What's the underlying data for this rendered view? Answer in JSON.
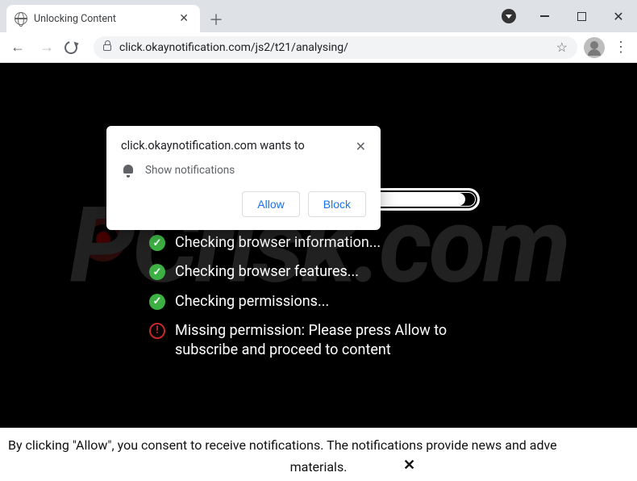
{
  "window": {
    "tab_title": "Unlocking Content"
  },
  "toolbar": {
    "url": "click.okaynotification.com/js2/t21/analysing/"
  },
  "permission_popup": {
    "origin_text": "click.okaynotification.com wants to",
    "request_label": "Show notifications",
    "allow_label": "Allow",
    "block_label": "Block"
  },
  "page": {
    "checks": [
      {
        "status": "ok",
        "text": "Checking browser information..."
      },
      {
        "status": "ok",
        "text": "Checking browser features..."
      },
      {
        "status": "ok",
        "text": "Checking permissions..."
      },
      {
        "status": "error",
        "text": "Missing permission: Please press Allow to subscribe and proceed to content"
      }
    ],
    "progress_percent": 97
  },
  "footer": {
    "line1": "By clicking \"Allow\", you consent to receive notifications. The notifications provide news and adve",
    "line2": "materials."
  },
  "watermark": "PCrisk.com"
}
